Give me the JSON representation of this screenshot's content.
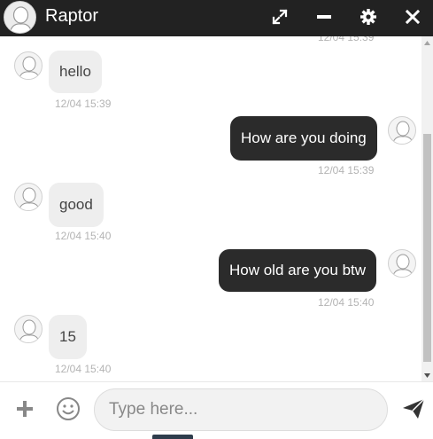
{
  "header": {
    "title": "Raptor",
    "background": "#222222"
  },
  "messages": [
    {
      "direction": "in",
      "text": "hello",
      "time": "12/04 15:39"
    },
    {
      "direction": "out",
      "text": "How are you doing",
      "time": "12/04 15:39"
    },
    {
      "direction": "in",
      "text": "good",
      "time": "12/04 15:40"
    },
    {
      "direction": "out",
      "text": "How old are you btw",
      "time": "12/04 15:40"
    },
    {
      "direction": "in",
      "text": "15",
      "time": "12/04 15:40"
    }
  ],
  "partial_top_time": "12/04 15:39",
  "composer": {
    "placeholder": "Type here..."
  },
  "icons": {
    "expand": "expand-icon",
    "minimize": "minimize-icon",
    "settings": "gear-icon",
    "close": "close-icon",
    "add": "plus-icon",
    "emoji": "smiley-icon",
    "send": "send-icon"
  }
}
